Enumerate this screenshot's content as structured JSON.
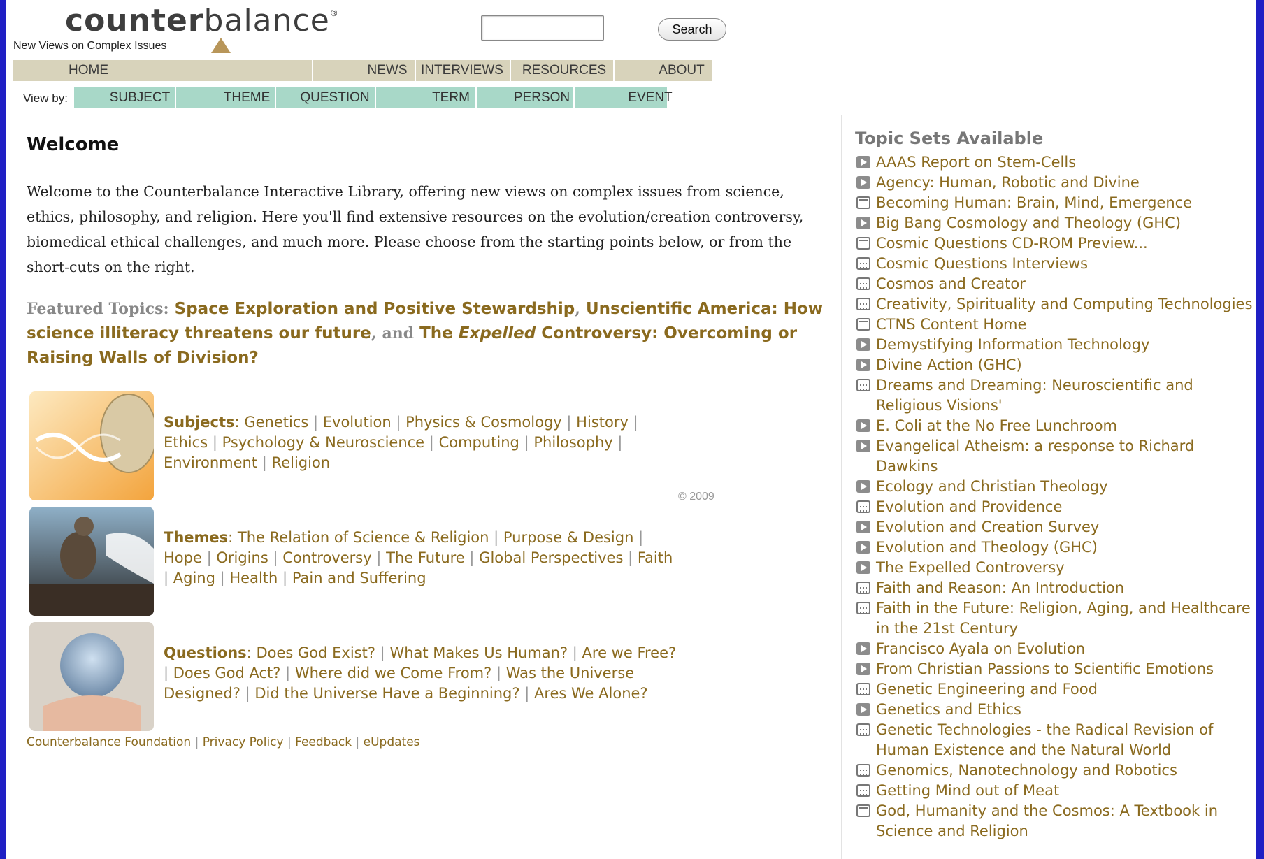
{
  "header": {
    "logo_bold": "counter",
    "logo_light": "balance",
    "logo_mark": "®",
    "tagline": "New Views on Complex Issues",
    "search_button": "Search",
    "search_value": ""
  },
  "nav": {
    "home": "HOME",
    "news": "NEWS",
    "interviews": "INTERVIEWS",
    "resources": "RESOURCES",
    "about": "ABOUT"
  },
  "viewby": {
    "label": "View by:",
    "subject": "SUBJECT",
    "theme": "THEME",
    "question": "QUESTION",
    "term": "TERM",
    "person": "PERSON",
    "event": "EVENT"
  },
  "welcome": {
    "title": "Welcome",
    "text": "Welcome to the Counterbalance Interactive Library, offering new views on complex issues from science, ethics, philosophy, and religion. Here you'll find extensive resources on the evolution/creation controversy, biomedical ethical challenges, and much more. Please choose from the starting points below, or from the short-cuts on the right."
  },
  "featured": {
    "label": "Featured Topics:",
    "topic1": "Space Exploration and Positive Stewardship",
    "topic2": "Unscientific America: How science illiteracy threatens our future",
    "and": "and",
    "topic3_pre": "The",
    "topic3_em": "Expelled",
    "topic3_post": "Controversy: Overcoming or Raising Walls of Division?"
  },
  "subjects": {
    "head": "Subjects",
    "links": [
      "Genetics",
      "Evolution",
      "Physics & Cosmology",
      "History",
      "Ethics",
      "Psychology & Neuroscience",
      "Computing",
      "Philosophy",
      "Environment",
      "Religion"
    ]
  },
  "themes": {
    "head": "Themes",
    "links": [
      "The Relation of Science & Religion",
      "Purpose & Design",
      "Hope",
      "Origins",
      "Controversy",
      "The Future",
      "Global Perspectives",
      "Faith",
      "Aging",
      "Health",
      "Pain and Suffering"
    ]
  },
  "questions": {
    "head": "Questions",
    "links": [
      "Does God Exist?",
      "What Makes Us Human?",
      "Are we Free?",
      "Does God Act?",
      "Where did we Come From?",
      "Was the Universe Designed?",
      "Did the Universe Have a Beginning?",
      "Ares We Alone?"
    ]
  },
  "copyright": "© 2009",
  "footer": {
    "links": [
      "Counterbalance Foundation",
      "Privacy Policy",
      "Feedback",
      "eUpdates"
    ]
  },
  "topics": {
    "title": "Topic Sets Available",
    "items": [
      {
        "label": "AAAS Report on Stem-Cells",
        "icon": "play"
      },
      {
        "label": "Agency: Human, Robotic and Divine",
        "icon": "play"
      },
      {
        "label": "Becoming Human: Brain, Mind, Emergence",
        "icon": "book"
      },
      {
        "label": "Big Bang Cosmology and Theology (GHC)",
        "icon": "play"
      },
      {
        "label": "Cosmic Questions CD-ROM Preview...",
        "icon": "book"
      },
      {
        "label": "Cosmic Questions Interviews",
        "icon": "video"
      },
      {
        "label": "Cosmos and Creator",
        "icon": "video"
      },
      {
        "label": "Creativity, Spirituality and Computing Technologies",
        "icon": "video"
      },
      {
        "label": "CTNS Content Home",
        "icon": "book"
      },
      {
        "label": "Demystifying Information Technology",
        "icon": "play"
      },
      {
        "label": "Divine Action (GHC)",
        "icon": "play"
      },
      {
        "label": "Dreams and Dreaming: Neuroscientific and Religious Visions'",
        "icon": "video"
      },
      {
        "label": "E. Coli at the No Free Lunchroom",
        "icon": "play"
      },
      {
        "label": "Evangelical Atheism: a response to Richard Dawkins",
        "icon": "play"
      },
      {
        "label": "Ecology and Christian Theology",
        "icon": "play"
      },
      {
        "label": "Evolution and Providence",
        "icon": "video"
      },
      {
        "label": "Evolution and Creation Survey",
        "icon": "play"
      },
      {
        "label": "Evolution and Theology (GHC)",
        "icon": "play"
      },
      {
        "label": "The Expelled Controversy",
        "icon": "play"
      },
      {
        "label": "Faith and Reason: An Introduction",
        "icon": "video"
      },
      {
        "label": "Faith in the Future: Religion, Aging, and Healthcare in the 21st Century",
        "icon": "video"
      },
      {
        "label": "Francisco Ayala on Evolution",
        "icon": "play"
      },
      {
        "label": "From Christian Passions to Scientific Emotions",
        "icon": "play"
      },
      {
        "label": "Genetic Engineering and Food",
        "icon": "video"
      },
      {
        "label": "Genetics and Ethics",
        "icon": "play"
      },
      {
        "label": "Genetic Technologies - the Radical Revision of Human Existence and the Natural World",
        "icon": "video"
      },
      {
        "label": "Genomics, Nanotechnology and Robotics",
        "icon": "video"
      },
      {
        "label": "Getting Mind out of Meat",
        "icon": "video"
      },
      {
        "label": "God, Humanity and the Cosmos: A Textbook in Science and Religion",
        "icon": "book"
      }
    ]
  }
}
